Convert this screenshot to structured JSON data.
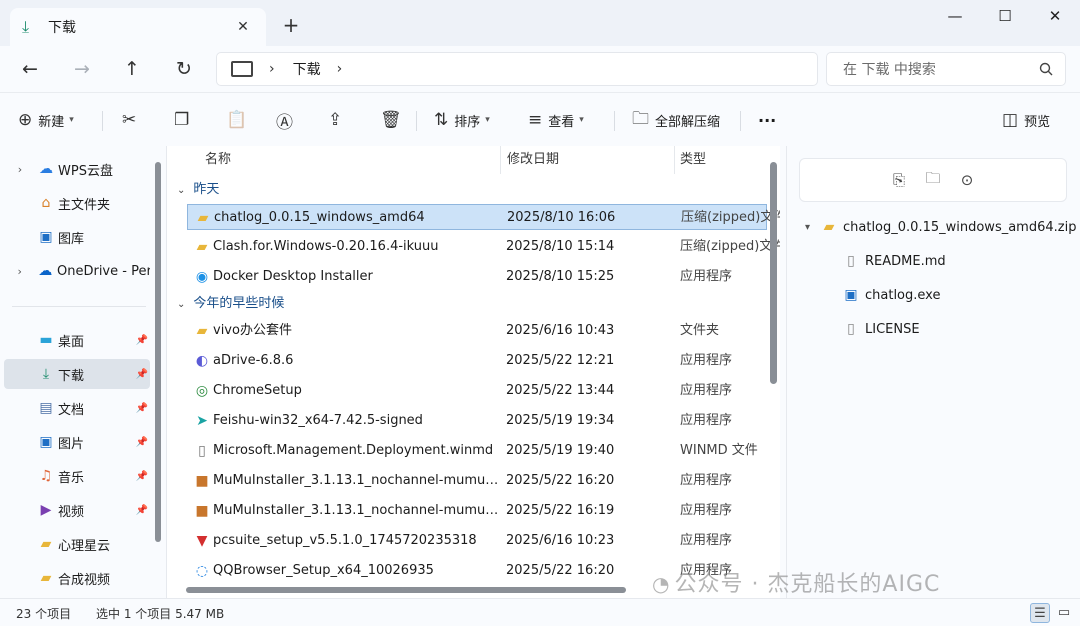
{
  "tab": {
    "icon": "download-icon",
    "label": "下载",
    "close": "✕",
    "new_tab": "+"
  },
  "window": {
    "minimize": "—",
    "maximize": "☐",
    "close": "✕"
  },
  "nav": {
    "back": "←",
    "forward": "→",
    "up": "↑",
    "refresh": "↻"
  },
  "address": {
    "separator": "›",
    "crumb": "下载",
    "trailing_separator": "›"
  },
  "search": {
    "placeholder": "在 下载 中搜索",
    "icon": "search-icon"
  },
  "toolbar": {
    "new_label": "新建",
    "sort_label": "排序",
    "view_label": "查看",
    "extract_label": "全部解压缩",
    "more": "···",
    "preview_label": "预览"
  },
  "sidebar": {
    "items": [
      {
        "label": "WPS云盘",
        "icon": "cloud-icon",
        "chevron": true
      },
      {
        "label": "主文件夹",
        "icon": "home-icon"
      },
      {
        "label": "图库",
        "icon": "gallery-icon"
      },
      {
        "label": "OneDrive - Per",
        "icon": "onedrive-icon",
        "chevron": true
      },
      {
        "label": "桌面",
        "icon": "desktop-icon",
        "pinned": true
      },
      {
        "label": "下载",
        "icon": "download-icon",
        "pinned": true,
        "selected": true
      },
      {
        "label": "文档",
        "icon": "documents-icon",
        "pinned": true
      },
      {
        "label": "图片",
        "icon": "pictures-icon",
        "pinned": true
      },
      {
        "label": "音乐",
        "icon": "music-icon",
        "pinned": true
      },
      {
        "label": "视频",
        "icon": "videos-icon",
        "pinned": true
      },
      {
        "label": "心理星云",
        "icon": "folder-icon"
      },
      {
        "label": "合成视频",
        "icon": "folder-icon"
      }
    ]
  },
  "columns": {
    "name": "名称",
    "modified": "修改日期",
    "type": "类型"
  },
  "groups": [
    {
      "label": "昨天",
      "files": [
        {
          "name": "chatlog_0.0.15_windows_amd64",
          "date": "2025/8/10 16:06",
          "type": "压缩(zipped)文件",
          "icon": "zip-folder-icon",
          "selected": true
        },
        {
          "name": "Clash.for.Windows-0.20.16.4-ikuuu",
          "date": "2025/8/10 15:14",
          "type": "压缩(zipped)文件",
          "icon": "zip-folder-icon"
        },
        {
          "name": "Docker Desktop Installer",
          "date": "2025/8/10 15:25",
          "type": "应用程序",
          "icon": "docker-icon"
        }
      ]
    },
    {
      "label": "今年的早些时候",
      "files": [
        {
          "name": "vivo办公套件",
          "date": "2025/6/16 10:43",
          "type": "文件夹",
          "icon": "folder-icon"
        },
        {
          "name": "aDrive-6.8.6",
          "date": "2025/5/22 12:21",
          "type": "应用程序",
          "icon": "adrive-icon"
        },
        {
          "name": "ChromeSetup",
          "date": "2025/5/22 13:44",
          "type": "应用程序",
          "icon": "chrome-icon"
        },
        {
          "name": "Feishu-win32_x64-7.42.5-signed",
          "date": "2025/5/19 19:34",
          "type": "应用程序",
          "icon": "feishu-icon"
        },
        {
          "name": "Microsoft.Management.Deployment.winmd",
          "date": "2025/5/19 19:40",
          "type": "WINMD 文件",
          "icon": "file-icon"
        },
        {
          "name": "MuMuInstaller_3.1.13.1_nochannel-mumu1...",
          "date": "2025/5/22 16:20",
          "type": "应用程序",
          "icon": "package-icon"
        },
        {
          "name": "MuMuInstaller_3.1.13.1_nochannel-mumu1...",
          "date": "2025/5/22 16:19",
          "type": "应用程序",
          "icon": "package-icon"
        },
        {
          "name": "pcsuite_setup_v5.5.1.0_1745720235318",
          "date": "2025/6/16 10:23",
          "type": "应用程序",
          "icon": "pcsuite-icon"
        },
        {
          "name": "QQBrowser_Setup_x64_10026935",
          "date": "2025/5/22 16:20",
          "type": "应用程序",
          "icon": "qqbrowser-icon"
        }
      ]
    }
  ],
  "preview": {
    "zip_name": "chatlog_0.0.15_windows_amd64.zip",
    "children": [
      {
        "name": "README.md",
        "icon": "file-icon"
      },
      {
        "name": "chatlog.exe",
        "icon": "exe-icon"
      },
      {
        "name": "LICENSE",
        "icon": "file-icon"
      }
    ]
  },
  "status": {
    "count": "23 个项目",
    "selection": "选中 1 个项目 5.47 MB"
  },
  "watermark": "公众号 · 杰克船长的AIGC",
  "colors": {
    "selection": "#cce2f8",
    "selection_border": "#8fb6de",
    "accent": "#0067c0"
  }
}
